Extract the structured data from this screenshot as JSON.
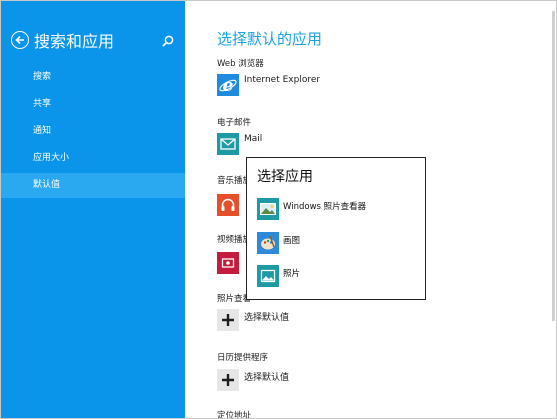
{
  "sidebar": {
    "title": "搜索和应用",
    "items": [
      {
        "label": "搜索"
      },
      {
        "label": "共享"
      },
      {
        "label": "通知"
      },
      {
        "label": "应用大小"
      },
      {
        "label": "默认值"
      }
    ],
    "active_item": "默认值"
  },
  "main": {
    "title": "选择默认的应用",
    "sections": [
      {
        "label": "Web 浏览器",
        "app": "Internet Explorer"
      },
      {
        "label": "电子邮件",
        "app": "Mail"
      },
      {
        "label": "音乐播放"
      },
      {
        "label": "视频播放"
      },
      {
        "label": "照片查看",
        "app": "选择默认值"
      },
      {
        "label": "日历提供程序",
        "app": "选择默认值"
      },
      {
        "label": "定位地址"
      }
    ]
  },
  "popup": {
    "title": "选择应用",
    "items": [
      {
        "label": "Windows 照片查看器"
      },
      {
        "label": "画图"
      },
      {
        "label": "照片"
      }
    ]
  },
  "colors": {
    "accent": "#0a95ea",
    "title_blue": "#1aa3e0",
    "ie_blue": "#1e8be0",
    "mail_teal": "#1d9aa3",
    "music_orange": "#e5502a",
    "video_red": "#c41a3e",
    "photos_teal": "#1d9aa3"
  }
}
